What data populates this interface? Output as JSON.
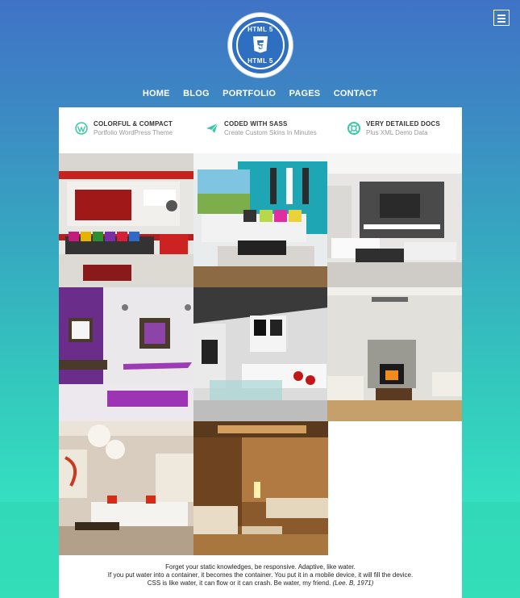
{
  "header": {
    "logo_top": "HTML 5",
    "logo_bottom": "HTML 5",
    "logo_badge": "HTML",
    "menu_icon": "hamburger-menu-icon"
  },
  "nav": {
    "items": [
      {
        "label": "HOME"
      },
      {
        "label": "BLOG"
      },
      {
        "label": "PORTFOLIO"
      },
      {
        "label": "PAGES"
      },
      {
        "label": "CONTACT"
      }
    ]
  },
  "features": [
    {
      "icon": "wordpress-icon",
      "title": "COLORFUL & COMPACT",
      "subtitle": "Portfolio WordPress Theme"
    },
    {
      "icon": "paper-plane-icon",
      "title": "CODED WITH SASS",
      "subtitle": "Create Custom Skins In Minutes"
    },
    {
      "icon": "lifebuoy-icon",
      "title": "VERY DETAILED DOCS",
      "subtitle": "Plus XML Demo Data"
    }
  ],
  "gallery": {
    "items": [
      {
        "name": "red-living-room"
      },
      {
        "name": "teal-living-room"
      },
      {
        "name": "gray-living-room"
      },
      {
        "name": "purple-living-room"
      },
      {
        "name": "white-living-room"
      },
      {
        "name": "fireplace-living-room"
      },
      {
        "name": "beige-living-room"
      },
      {
        "name": "wood-living-room"
      }
    ]
  },
  "quote": {
    "line1": "Forget your static knowledges, be responsive. Adaptive, like water.",
    "line2": "If you put water into a container, it becomes the container. You put it in a mobile device, it will fill the device.",
    "line3": "CSS is like water, it can flow or it can crash. Be water, my friend.",
    "cite": "(Lee. B, 1971)"
  },
  "colors": {
    "accent_green": "#3cc6a8",
    "background_top": "#3f73c6",
    "background_bottom": "#38e6be"
  }
}
